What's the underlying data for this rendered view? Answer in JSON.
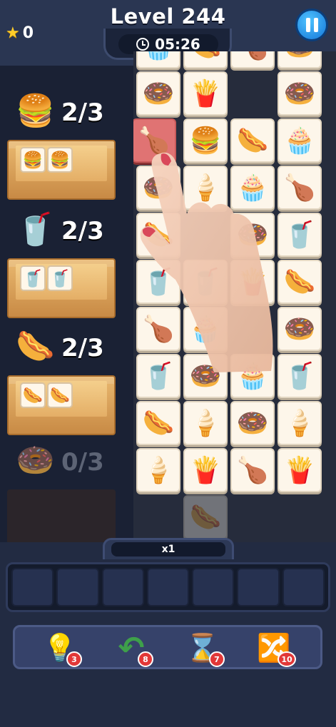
{
  "header": {
    "stars": "0",
    "level_title": "Level 244",
    "timer": "05:26"
  },
  "goals": [
    {
      "icon": "burger",
      "glyph": "🍔",
      "count": "2/3",
      "tray_glyphs": [
        "🍔",
        "🍔"
      ]
    },
    {
      "icon": "soda-cup",
      "glyph": "🥤",
      "count": "2/3",
      "tray_glyphs": [
        "🥤",
        "🥤"
      ]
    },
    {
      "icon": "hotdog",
      "glyph": "🌭",
      "count": "2/3",
      "tray_glyphs": [
        "🌭",
        "🌭"
      ]
    },
    {
      "icon": "donut",
      "glyph": "🍩",
      "count": "0/3",
      "tray_glyphs": []
    }
  ],
  "board": {
    "rows": [
      [
        "🧁",
        "🌭",
        "🍗",
        "🍩"
      ],
      [
        "🍩",
        "🍟",
        "",
        "🍩"
      ],
      [
        "🍗",
        "🍔",
        "🌭",
        "🧁"
      ],
      [
        "🍩",
        "🍦",
        "🧁",
        "🍗"
      ],
      [
        "🌭",
        "",
        "🍩",
        "🥤"
      ],
      [
        "🥤",
        "🥤",
        "🍟",
        "🌭"
      ],
      [
        "🍗",
        "🧁",
        "",
        "🍩"
      ],
      [
        "🥤",
        "🍩",
        "🧁",
        "🥤"
      ],
      [
        "🌭",
        "🍦",
        "🍩",
        "🍦"
      ],
      [
        "🍦",
        "🍟",
        "🍗",
        "🍟"
      ],
      [
        "",
        "🌭",
        "",
        ""
      ]
    ],
    "selected": "🍗"
  },
  "multiplier": "x1",
  "slots_count": 7,
  "powerups": [
    {
      "name": "hint-bulb",
      "glyph": "💡",
      "count": "3"
    },
    {
      "name": "undo",
      "glyph": "↶",
      "count": "8"
    },
    {
      "name": "hourglass",
      "glyph": "⌛",
      "count": "7"
    },
    {
      "name": "shuffle",
      "glyph": "🔀",
      "count": "10"
    }
  ]
}
